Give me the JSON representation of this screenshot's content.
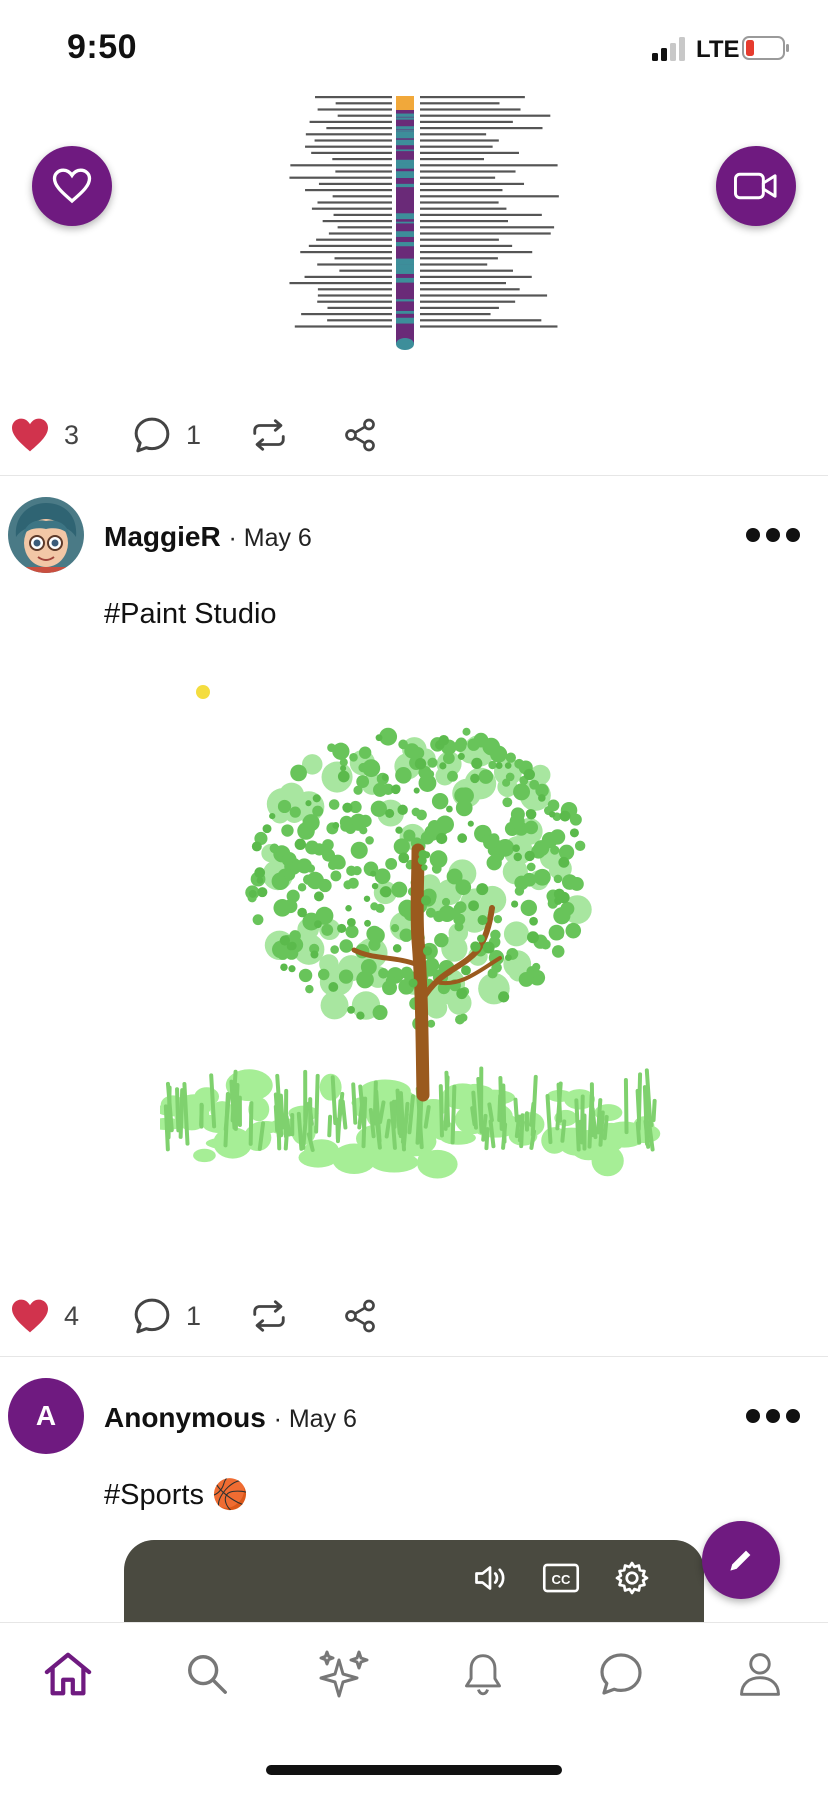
{
  "status_bar": {
    "time": "9:50",
    "network": "LTE"
  },
  "colors": {
    "brand_purple": "#6f1a80",
    "like_red": "#d1334d",
    "divider": "#e6e6e6"
  },
  "floating_buttons": {
    "left_icon": "heart-outline-icon",
    "right_icon": "video-camera-icon",
    "compose_icon": "pencil-icon"
  },
  "posts": [
    {
      "likes": "3",
      "comments": "1"
    },
    {
      "author": "MaggieR",
      "date": "· May 6",
      "text": "#Paint Studio",
      "likes": "4",
      "comments": "1"
    },
    {
      "author": "Anonymous",
      "avatar_letter": "A",
      "date": "· May 6",
      "text": "#Sports 🏀"
    }
  ],
  "video_controls": [
    "volume-icon",
    "closed-captions-icon",
    "settings-gear-icon"
  ],
  "tab_bar": [
    "home-icon",
    "search-icon",
    "sparkles-icon",
    "bell-icon",
    "chat-icon",
    "profile-icon"
  ]
}
